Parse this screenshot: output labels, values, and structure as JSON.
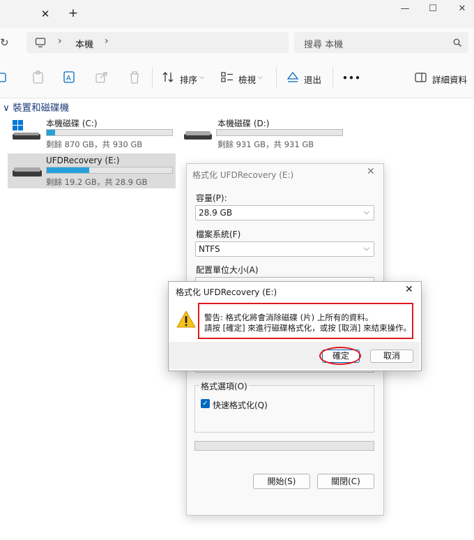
{
  "window": {
    "tab_close": "✕",
    "tab_new": "+",
    "minimize": "—",
    "maximize": "☐",
    "close": "✕"
  },
  "address": {
    "separator": "›",
    "location": "本機",
    "search_placeholder": "搜尋 本機"
  },
  "toolbar": {
    "sort_label": "排序",
    "view_label": "檢視",
    "eject_label": "退出",
    "more_label": "•••",
    "details_label": "詳細資料"
  },
  "section": {
    "title": "裝置和磁碟機",
    "chevron": "∨"
  },
  "drives": [
    {
      "name": "本機磁碟 (C:)",
      "free_text": "剩餘 870 GB，共 930 GB",
      "used_fraction": 0.065
    },
    {
      "name": "本機磁碟 (D:)",
      "free_text": "剩餘 931 GB，共 931 GB",
      "used_fraction": 0.0
    },
    {
      "name": "UFDRecovery (E:)",
      "free_text": "剩餘 19.2 GB，共 28.9 GB",
      "used_fraction": 0.34
    }
  ],
  "format_dialog": {
    "title": "格式化 UFDRecovery (E:)",
    "close": "✕",
    "capacity_label": "容量(P):",
    "capacity_value": "28.9 GB",
    "fs_label": "檔案系統(F)",
    "fs_value": "NTFS",
    "alloc_label": "配置單位大小(A)",
    "options_label": "格式選項(O)",
    "quick_format_label": "快速格式化(Q)",
    "checkmark": "✓",
    "chevron": "⌵",
    "start_button": "開始(S)",
    "close_button": "關閉(C)"
  },
  "warning_dialog": {
    "title": "格式化 UFDRecovery (E:)",
    "close": "✕",
    "icon_glyph": "!",
    "line1": "警告: 格式化將會消除磁碟 (片) 上所有的資料。",
    "line2": "請按 [確定] 來進行磁碟格式化，或按 [取消] 來結束操作。",
    "ok_button": "確定",
    "cancel_button": "取消"
  },
  "colors": {
    "accent": "#0067c0",
    "bar_fill": "#26a0da",
    "highlight_red": "#e0181c",
    "warning_yellow": "#f7c21b"
  }
}
